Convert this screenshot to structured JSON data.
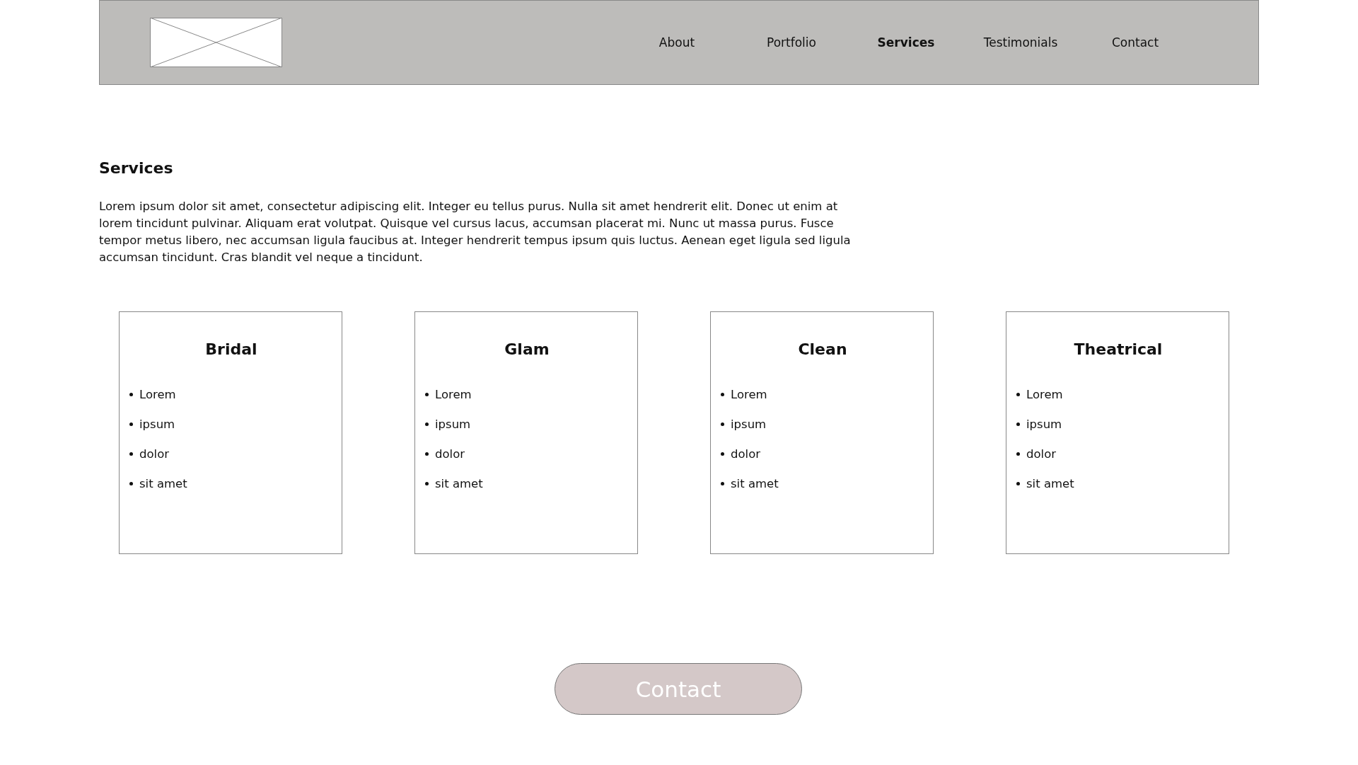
{
  "header": {
    "nav": [
      {
        "label": "About",
        "selected": false
      },
      {
        "label": "Portfolio",
        "selected": false
      },
      {
        "label": "Services",
        "selected": true
      },
      {
        "label": "Testimonials",
        "selected": false
      },
      {
        "label": "Contact",
        "selected": false
      }
    ]
  },
  "heading": "Services",
  "intro": "Lorem ipsum dolor sit amet, consectetur adipiscing elit. Integer eu tellus purus. Nulla sit amet hendrerit elit. Donec ut enim at lorem tincidunt pulvinar. Aliquam erat volutpat. Quisque vel cursus lacus, accumsan placerat mi. Nunc ut massa purus. Fusce tempor metus libero, nec accumsan ligula faucibus at. Integer hendrerit tempus ipsum quis luctus. Aenean eget ligula sed ligula accumsan tincidunt. Cras blandit vel neque a tincidunt.",
  "cards": [
    {
      "title": "Bridal",
      "items": [
        "Lorem",
        "ipsum",
        "dolor",
        "sit amet"
      ]
    },
    {
      "title": "Glam",
      "items": [
        "Lorem",
        "ipsum",
        "dolor",
        "sit amet"
      ]
    },
    {
      "title": "Clean",
      "items": [
        "Lorem",
        "ipsum",
        "dolor",
        "sit amet"
      ]
    },
    {
      "title": "Theatrical",
      "items": [
        "Lorem",
        "ipsum",
        "dolor",
        "sit amet"
      ]
    }
  ],
  "button": "Contact"
}
